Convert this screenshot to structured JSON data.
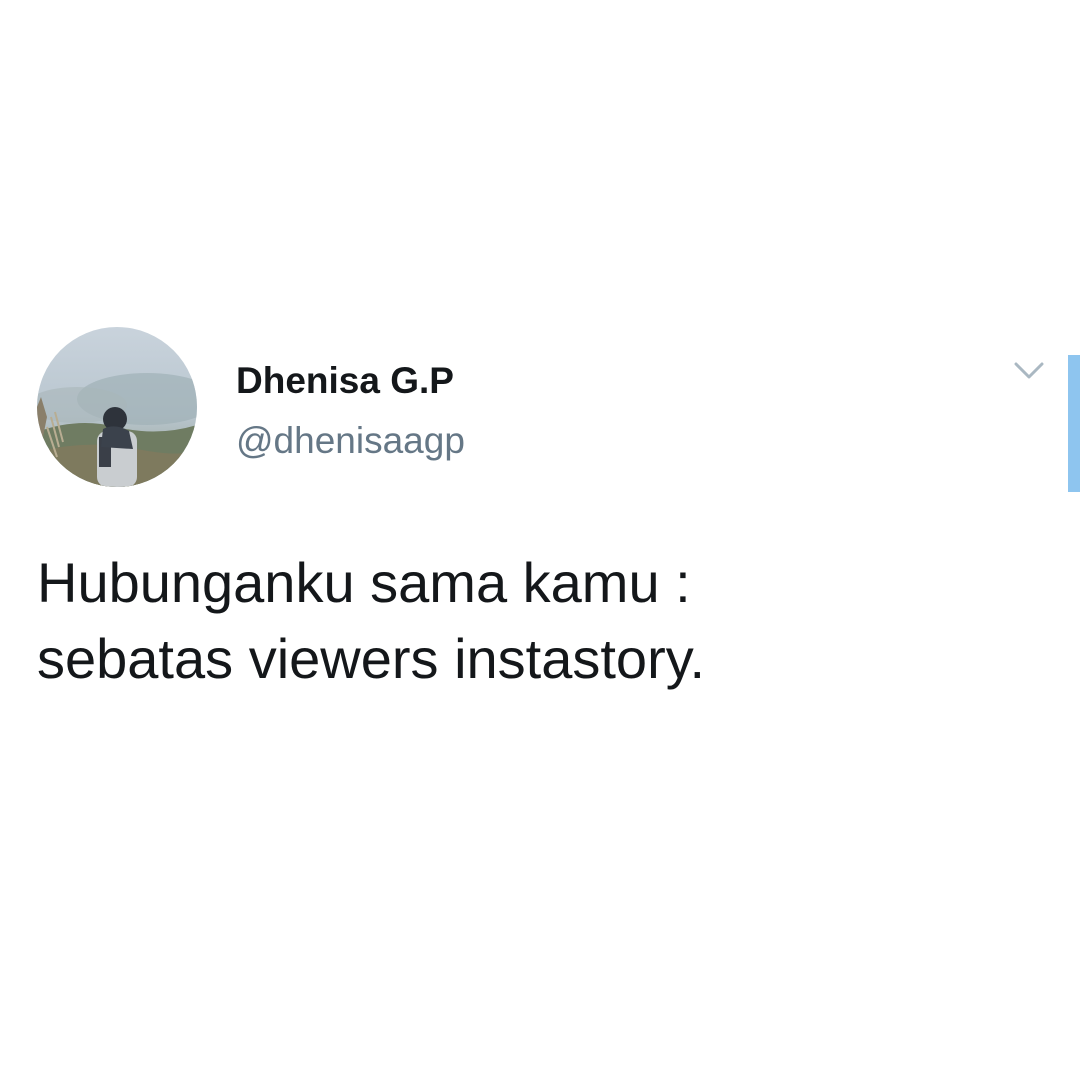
{
  "tweet": {
    "author": {
      "display_name": "Dhenisa G.P",
      "handle": "@dhenisaagp"
    },
    "text_lines": [
      "Hubunganku sama kamu :",
      "sebatas viewers instastory."
    ],
    "menu_icon": "chevron-down-icon"
  },
  "colors": {
    "name_text": "#14171a",
    "handle_text": "#657786",
    "caret": "#aab8c2",
    "accent": "#8ec5ef",
    "background": "#ffffff"
  }
}
